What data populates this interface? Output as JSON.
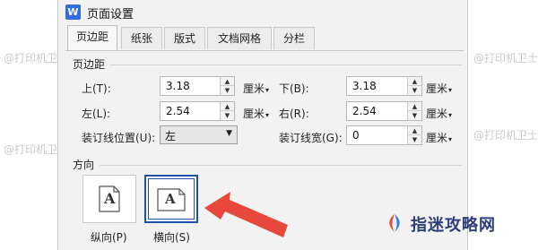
{
  "dialog": {
    "app_icon": "W",
    "title": "页面设置"
  },
  "tabs": [
    {
      "label": "页边距",
      "active": true
    },
    {
      "label": "纸张",
      "active": false
    },
    {
      "label": "版式",
      "active": false
    },
    {
      "label": "文档网格",
      "active": false
    },
    {
      "label": "分栏",
      "active": false
    }
  ],
  "margins": {
    "section_title": "页边距",
    "top": {
      "label": "上(T):",
      "value": "3.18",
      "unit": "厘米"
    },
    "bottom": {
      "label": "下(B):",
      "value": "3.18",
      "unit": "厘米"
    },
    "left": {
      "label": "左(L):",
      "value": "2.54",
      "unit": "厘米"
    },
    "right": {
      "label": "右(R):",
      "value": "2.54",
      "unit": "厘米"
    },
    "gutter_position": {
      "label": "装订线位置(U):",
      "value": "左"
    },
    "gutter_width": {
      "label": "装订线宽(G):",
      "value": "0",
      "unit": "厘米"
    }
  },
  "orientation": {
    "section_title": "方向",
    "portrait": {
      "label": "纵向(P)",
      "letter": "A",
      "selected": false
    },
    "landscape": {
      "label": "横向(S)",
      "letter": "A",
      "selected": true
    }
  },
  "watermark_text": "@打印机卫士",
  "brand": {
    "name": "指迷攻略网",
    "color": "#2d3e7a",
    "accent_colors": [
      "#e8483b",
      "#2f7de1"
    ]
  },
  "colors": {
    "selection_border": "#1f4fa8",
    "arrow": "#e8483b"
  }
}
